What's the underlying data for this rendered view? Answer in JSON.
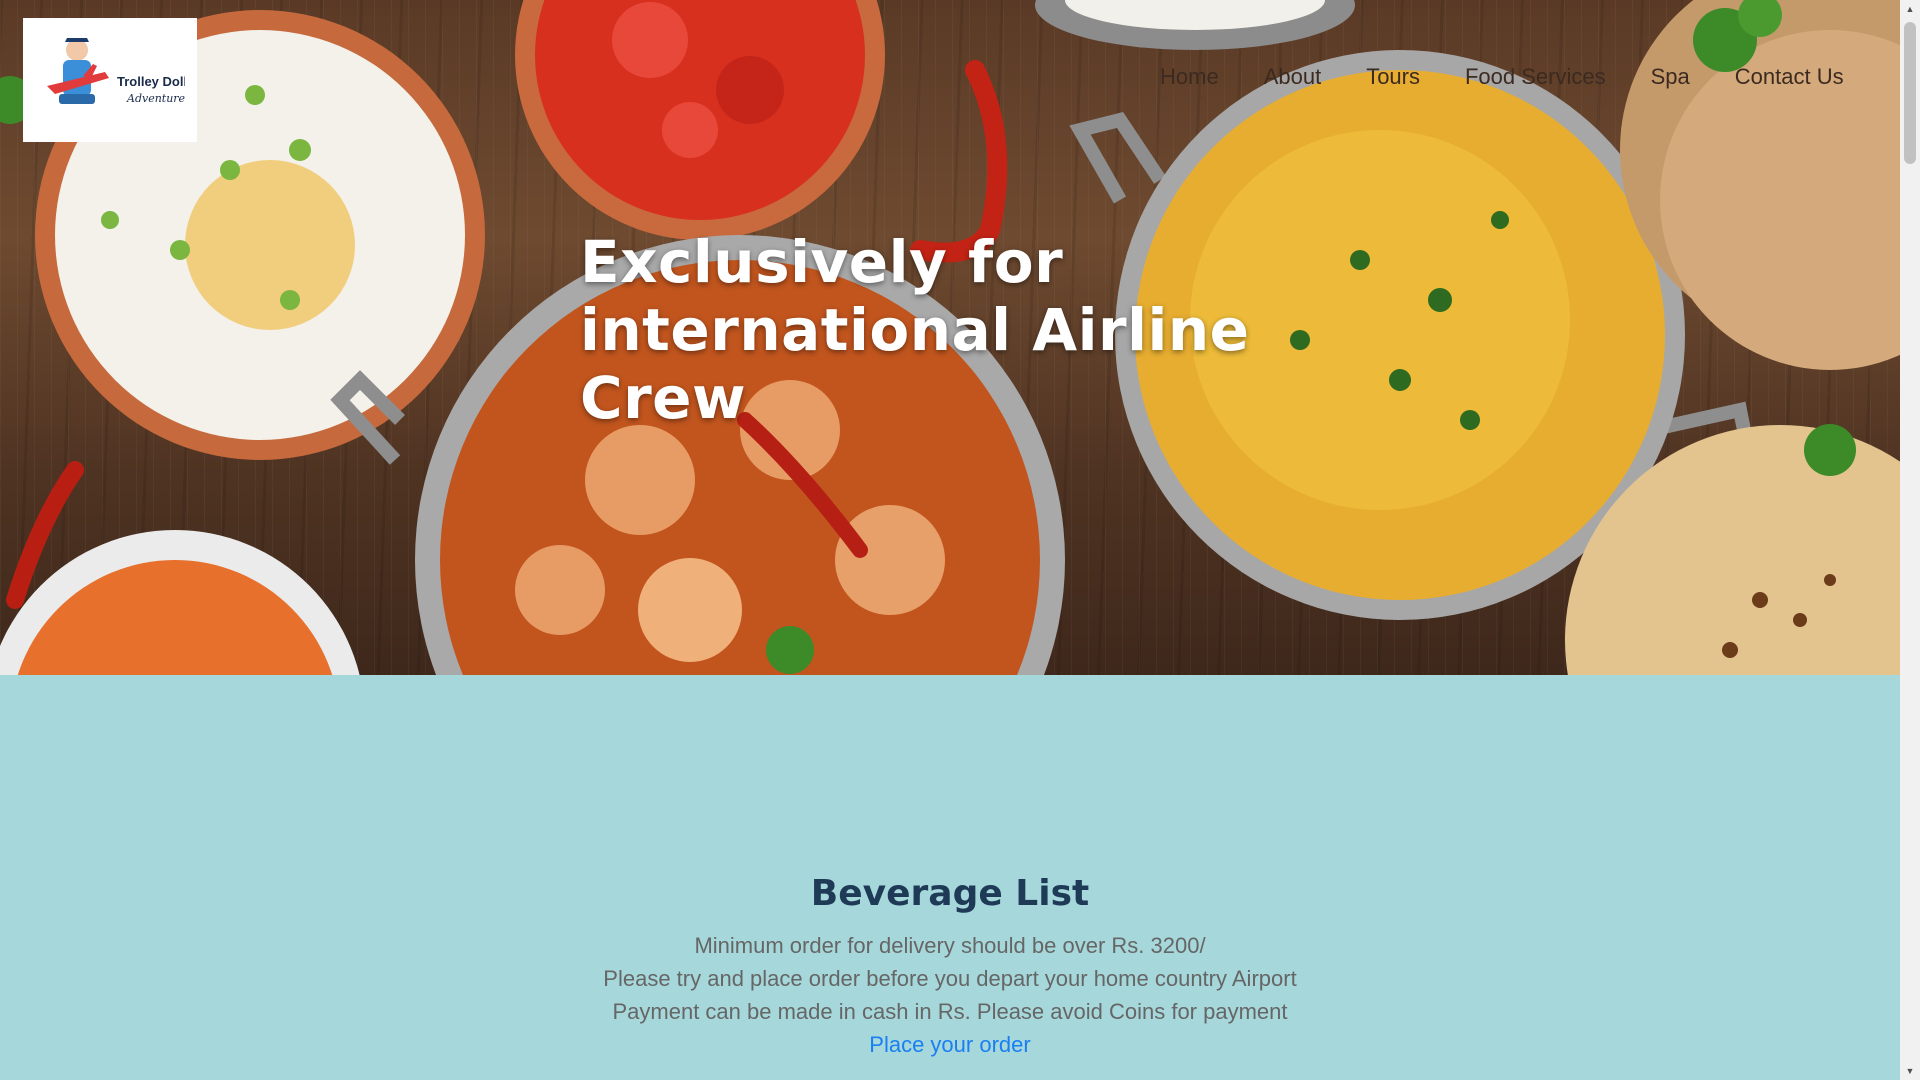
{
  "logo": {
    "line1": "Trolley Dolly",
    "line2": "Adventures",
    "icon": "airline-crew-plane-icon"
  },
  "nav": {
    "items": [
      {
        "label": "Home"
      },
      {
        "label": "About"
      },
      {
        "label": "Tours"
      },
      {
        "label": "Food Services"
      },
      {
        "label": "Spa"
      },
      {
        "label": "Contact Us"
      }
    ]
  },
  "hero": {
    "title_line1": "Exclusively for",
    "title_line2": "international Airline",
    "title_line3": "Crew"
  },
  "section": {
    "title": "Beverage List",
    "line1": "Minimum order for delivery should be over Rs. 3200/",
    "line2": "Please try and place order before you depart your home country Airport",
    "line3": "Payment can be made in cash in Rs. Please avoid Coins for payment",
    "link": "Place your order"
  },
  "colors": {
    "content_bg": "#a6d8db",
    "section_title": "#1f3a57",
    "body_text": "#666666",
    "link": "#1a7ff2"
  }
}
